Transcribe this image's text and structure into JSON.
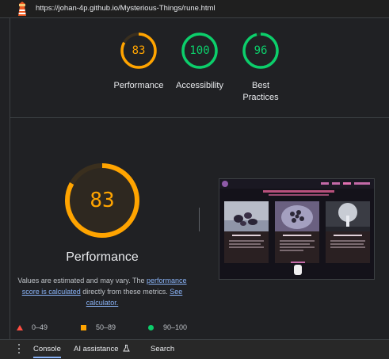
{
  "url": "https://johan-4p.github.io/Mysterious-Things/rune.html",
  "summary": [
    {
      "score": "83",
      "label": "Performance",
      "color": "#ffa400",
      "fraction": 0.83
    },
    {
      "score": "100",
      "label": "Accessibility",
      "color": "#0cce6b",
      "fraction": 1.0
    },
    {
      "score": "96",
      "label_line1": "Best",
      "label_line2": "Practices",
      "color": "#0cce6b",
      "fraction": 0.96
    }
  ],
  "main": {
    "score": "83",
    "fraction": 0.83,
    "title": "Performance",
    "desc_1": "Values are estimated and may vary. The",
    "desc_link1": "performance score is calculated",
    "desc_2": " directly from these metrics. ",
    "desc_link2": "See calculator."
  },
  "legend": [
    {
      "range": "0–49",
      "icon": "triangle-icon",
      "color": "#ff4e42"
    },
    {
      "range": "50–89",
      "icon": "square-icon",
      "color": "#ffa400"
    },
    {
      "range": "90–100",
      "icon": "circle-icon",
      "color": "#0cce6b"
    }
  ],
  "drawer": {
    "tabs": [
      "Console",
      "AI assistance",
      "Search"
    ],
    "active": "Console"
  }
}
